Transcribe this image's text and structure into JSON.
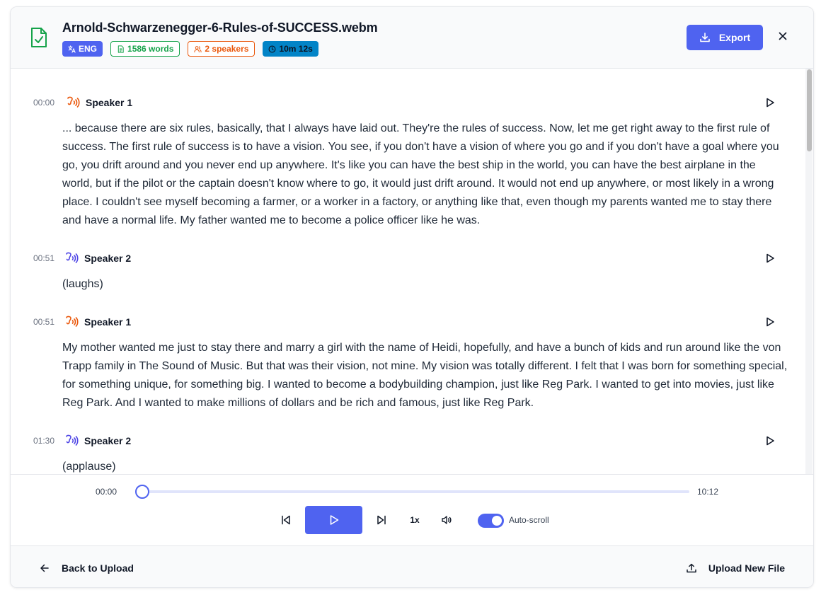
{
  "header": {
    "title": "Arnold-Schwarzenegger-6-Rules-of-SUCCESS.webm",
    "badges": {
      "language": "ENG",
      "words": "1586 words",
      "speakers": "2 speakers",
      "duration": "10m 12s"
    },
    "export_label": "Export"
  },
  "transcript": {
    "segments": [
      {
        "time": "00:00",
        "speaker": "Speaker 1",
        "text": "... because there are six rules, basically, that I always have laid out. They're the rules of success. Now, let me get right away to the first rule of success. The first rule of success is to have a vision. You see, if you don't have a vision of where you go and if you don't have a goal where you go, you drift around and you never end up anywhere. It's like you can have the best ship in the world, you can have the best airplane in the world, but if the pilot or the captain doesn't know where to go, it would just drift around. It would not end up anywhere, or most likely in a wrong place. I couldn't see myself becoming a farmer, or a worker in a factory, or anything like that, even though my parents wanted me to stay there and have a normal life. My father wanted me to become a police officer like he was."
      },
      {
        "time": "00:51",
        "speaker": "Speaker 2",
        "text": "(laughs)"
      },
      {
        "time": "00:51",
        "speaker": "Speaker 1",
        "text": "My mother wanted me just to stay there and marry a girl with the name of Heidi, hopefully, and have a bunch of kids and run around like the von Trapp family in The Sound of Music. But that was their vision, not mine. My vision was totally different. I felt that I was born for something special, for something unique, for something big. I wanted to become a bodybuilding champion, just like Reg Park. I wanted to get into movies, just like Reg Park. And I wanted to make millions of dollars and be rich and famous, just like Reg Park."
      },
      {
        "time": "01:30",
        "speaker": "Speaker 2",
        "text": "(applause)"
      }
    ],
    "speaker_colors": {
      "Speaker 1": "#ea580c",
      "Speaker 2": "#4f46e5"
    }
  },
  "player": {
    "current_time": "00:00",
    "total_time": "10:12",
    "progress": 0.0,
    "speed": "1x",
    "autoscroll_label": "Auto-scroll",
    "autoscroll_on": true
  },
  "footer": {
    "back_label": "Back to Upload",
    "upload_label": "Upload New File"
  },
  "colors": {
    "accent": "#4f63f0",
    "words_green": "#16a34a",
    "speakers_orange": "#ea580c",
    "duration_blue": "#0284c7"
  }
}
